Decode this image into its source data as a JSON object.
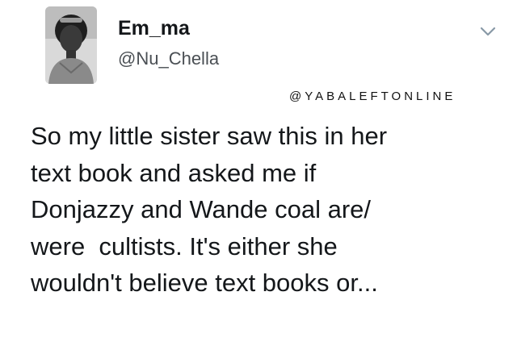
{
  "author": {
    "display_name": "Em_ma",
    "handle": "@Nu_Chella"
  },
  "icons": {
    "avatar": "profile-photo",
    "menu": "chevron-down-icon"
  },
  "watermark": "@YABALEFTONLINE",
  "tweet": {
    "lines": [
      "So my little sister saw this in her",
      "text book and asked me if",
      "Donjazzy and Wande coal are/",
      "were  cultists. It's either she",
      "wouldn't believe text books or..."
    ]
  },
  "colors": {
    "text": "#14171a",
    "secondary_text": "#4a4f54",
    "background": "#ffffff"
  }
}
